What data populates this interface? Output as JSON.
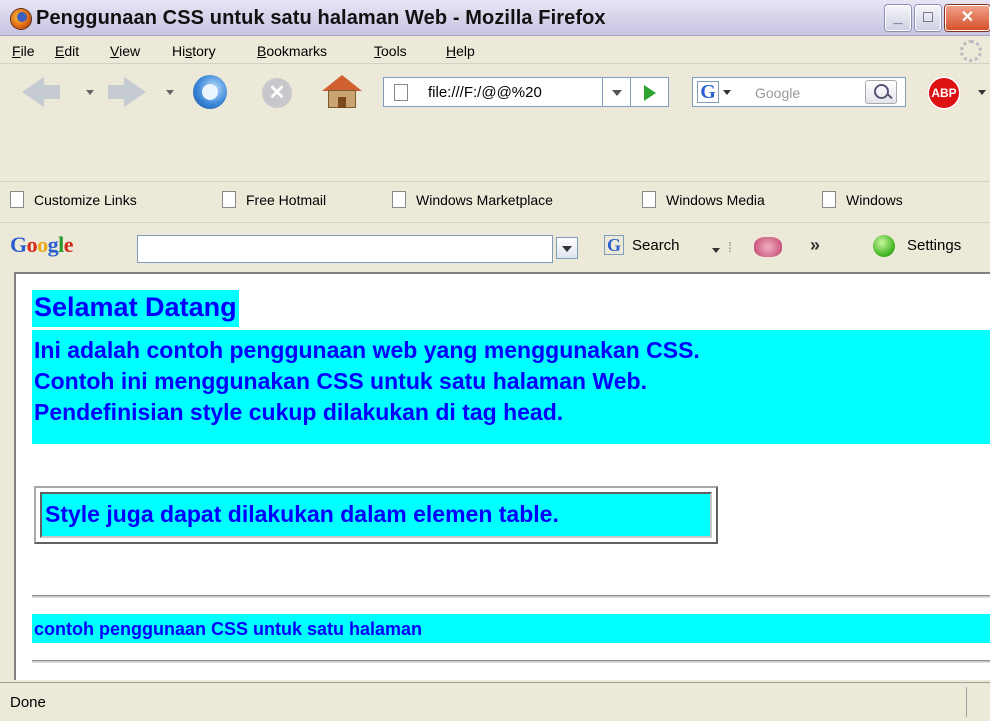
{
  "window": {
    "title": "Penggunaan CSS untuk satu halaman Web - Mozilla Firefox",
    "minimize": "_",
    "maximize": "□",
    "close": "✕",
    "icons": {
      "app": "firefox-icon"
    }
  },
  "menu": {
    "items": [
      {
        "ul": "F",
        "rest": "ile"
      },
      {
        "ul": "E",
        "rest": "dit"
      },
      {
        "ul": "V",
        "rest": "iew"
      },
      {
        "pre": "Hi",
        "ul": "s",
        "rest": "tory"
      },
      {
        "ul": "B",
        "rest": "ookmarks"
      },
      {
        "ul": "T",
        "rest": "ools"
      },
      {
        "ul": "H",
        "rest": "elp"
      }
    ]
  },
  "navigation": {
    "url": "file:///F:/@@%20",
    "search_placeholder": "Google",
    "stop_glyph": "✕",
    "abp_label": "ABP",
    "icons": [
      "back-arrow-icon",
      "forward-arrow-icon",
      "reload-icon",
      "stop-icon",
      "home-icon",
      "page-icon",
      "go-icon",
      "google-icon",
      "search-icon",
      "adblock-icon"
    ]
  },
  "bookmarks": {
    "items": [
      "Customize Links",
      "Free Hotmail",
      "Windows Marketplace",
      "Windows Media",
      "Windows"
    ]
  },
  "google_toolbar": {
    "logo": "Google",
    "logo_letters": [
      "G",
      "o",
      "o",
      "g",
      "l",
      "e"
    ],
    "logo_colors": [
      "#2a5fd0",
      "#d42a1a",
      "#e8a914",
      "#2a5fd0",
      "#2a9a2a",
      "#d42a1a"
    ],
    "search_label": "Search",
    "g_letter": "G",
    "more": "»",
    "settings": "Settings"
  },
  "page": {
    "heading": "Selamat Datang",
    "paragraph_lines": [
      "Ini adalah contoh penggunaan web yang menggunakan CSS.",
      "Contoh ini menggunakan CSS untuk satu halaman Web.",
      "Pendefinisian style cukup dilakukan di tag head."
    ],
    "table_cell": "Style juga dapat dilakukan dalam elemen table.",
    "footer": "contoh penggunaan CSS untuk satu halaman",
    "colors": {
      "background": "#00ffff",
      "text": "#0000ff"
    }
  },
  "status": {
    "text": "Done"
  }
}
